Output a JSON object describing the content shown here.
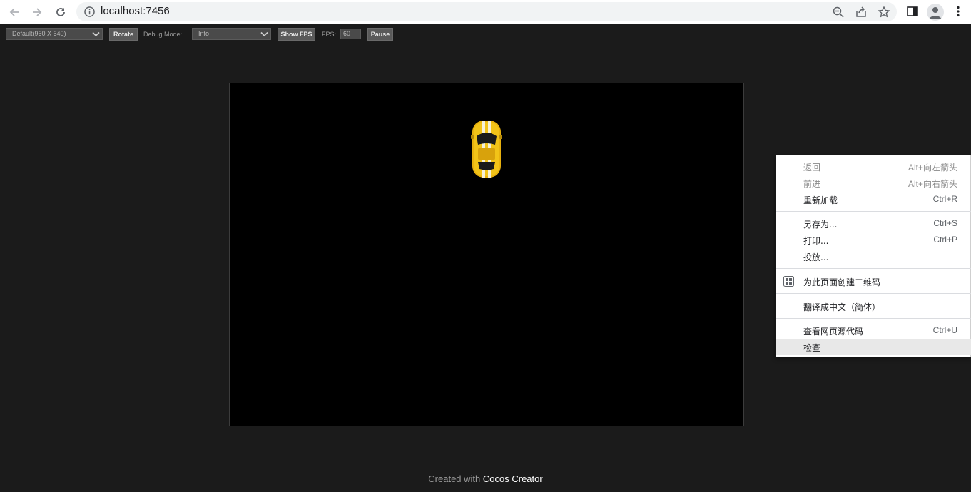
{
  "browser": {
    "url": "localhost:7456"
  },
  "toolbar": {
    "resolution_value": "Default(960 X 640)",
    "rotate_label": "Rotate",
    "debug_mode_label": "Debug Mode:",
    "debug_mode_value": "Info",
    "show_fps_label": "Show FPS",
    "fps_label": "FPS:",
    "fps_value": "60",
    "pause_label": "Pause"
  },
  "footer": {
    "prefix": "Created with",
    "link": "Cocos Creator"
  },
  "context_menu": {
    "back": {
      "label": "返回",
      "shortcut": "Alt+向左箭头"
    },
    "forward": {
      "label": "前进",
      "shortcut": "Alt+向右箭头"
    },
    "reload": {
      "label": "重新加载",
      "shortcut": "Ctrl+R"
    },
    "save_as": {
      "label": "另存为...",
      "shortcut": "Ctrl+S"
    },
    "print": {
      "label": "打印...",
      "shortcut": "Ctrl+P"
    },
    "cast": {
      "label": "投放..."
    },
    "qr_code": {
      "label": "为此页面创建二维码"
    },
    "translate": {
      "label": "翻译成中文（简体）"
    },
    "view_source": {
      "label": "查看网页源代码",
      "shortcut": "Ctrl+U"
    },
    "inspect": {
      "label": "检查"
    }
  }
}
